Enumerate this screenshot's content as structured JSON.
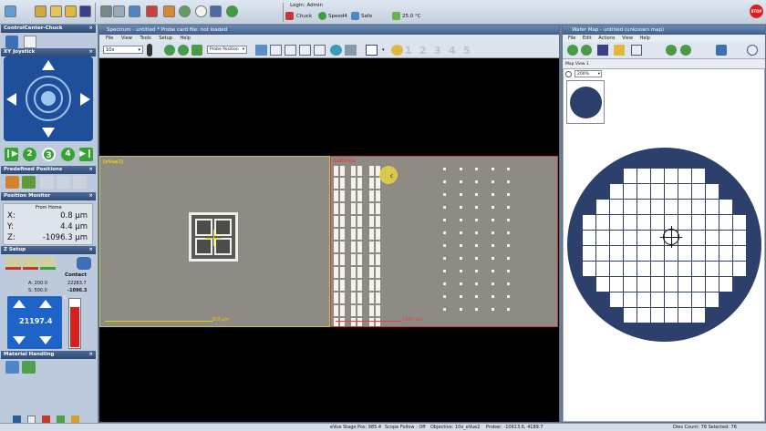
{
  "app": {
    "login_text": "Login: Admin",
    "chuck_label": "Chuck",
    "speed_label": "Speed4",
    "safe_label": "Safe",
    "temperature": "25.0 °C",
    "stop_label": "STOP"
  },
  "left_panel": {
    "control_center_title": "ControlCenter-Chuck",
    "xy_joystick_title": "XY Joystick",
    "speed_steps": [
      "1",
      "2",
      "3",
      "4"
    ],
    "predefined_positions_title": "Predefined Positions",
    "position_monitor_title": "Position Monitor",
    "position_mode": "From Home",
    "x_label": "X:",
    "x_value": "0.8 µm",
    "y_label": "Y:",
    "y_value": "4.4 µm",
    "z_label": "Z:",
    "z_value": "-1096.3 µm",
    "z_setup_title": "Z Setup",
    "a_value": "A: 200.0",
    "s_value": "S: 500.0",
    "contact_label": "Contact",
    "contact_value": "22283.7",
    "contact_delta": "-1096.3",
    "z_display": "21197.4",
    "c_label": "C",
    "material_handling_title": "Material Handling"
  },
  "spectrum": {
    "title": "Spectrum - untitled * Probe card file: not loaded",
    "menu": [
      "File",
      "View",
      "Tools",
      "Setup",
      "Help"
    ],
    "objective_select": "10x",
    "mode_select": "Probe Position",
    "numbers": [
      "1",
      "2",
      "3",
      "4",
      "5"
    ],
    "view1_label": "[eVue2]",
    "view1_scale": "300 µm",
    "view2_label": "CellView",
    "view2_scale": "1000 µm",
    "cursor_letter": "c"
  },
  "wafer_map": {
    "title": "Wafer Map - untitled (unknown map)",
    "menu": [
      "File",
      "Edit",
      "Actions",
      "View",
      "Help"
    ],
    "map_view_label": "Map View 1",
    "zoom_value": "200%"
  },
  "status": {
    "stage_pos": "eVue Stage Pos: 985.4",
    "scope_follow": "Scope Follow : Off",
    "objective": "Objective: 10x_eVue2",
    "prober": "Prober: -10613.6, 4189.7",
    "die_count": "Dies Count: 76 Selected: 76"
  },
  "colors": {
    "title_bar": "#3f5e8d",
    "joystick_blue": "#1f4f9a",
    "wafer_navy": "#2d3f6b",
    "crosshair_yellow": "#e8d000",
    "cellview_red": "#c84040",
    "stop_red": "#d82020"
  }
}
